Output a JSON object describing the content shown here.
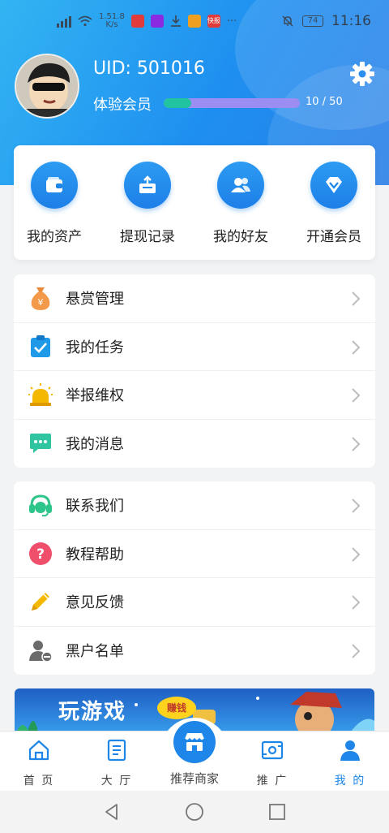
{
  "status_bar": {
    "speed": "1.51.8",
    "speed_unit": "K/s",
    "app_badge_text": "快报",
    "more": "···",
    "battery": "74",
    "time": "11:16"
  },
  "profile": {
    "uid": "UID: 501016",
    "member_level": "体验会员",
    "progress_text": "10 / 50",
    "progress_value": 10,
    "progress_max": 50
  },
  "quick_actions": [
    {
      "label": "我的资产",
      "icon": "wallet-icon"
    },
    {
      "label": "提现记录",
      "icon": "withdraw-icon"
    },
    {
      "label": "我的好友",
      "icon": "friends-icon"
    },
    {
      "label": "开通会员",
      "icon": "diamond-icon"
    }
  ],
  "menu_group1": [
    {
      "label": "悬赏管理",
      "icon": "money-bag-icon"
    },
    {
      "label": "我的任务",
      "icon": "task-check-icon"
    },
    {
      "label": "举报维权",
      "icon": "alarm-light-icon"
    },
    {
      "label": "我的消息",
      "icon": "message-icon"
    }
  ],
  "menu_group2": [
    {
      "label": "联系我们",
      "icon": "headset-icon"
    },
    {
      "label": "教程帮助",
      "icon": "help-icon"
    },
    {
      "label": "意见反馈",
      "icon": "pencil-icon"
    },
    {
      "label": "黑户名单",
      "icon": "blocked-user-icon"
    }
  ],
  "banner": {
    "title": "玩游戏",
    "tag": "赚钱"
  },
  "tabs": [
    {
      "label": "首 页",
      "icon": "home-icon",
      "active": false
    },
    {
      "label": "大 厅",
      "icon": "hall-icon",
      "active": false
    },
    {
      "label": "推荐商家",
      "icon": "store-icon",
      "active": false
    },
    {
      "label": "推 广",
      "icon": "promote-icon",
      "active": false
    },
    {
      "label": "我 的",
      "icon": "user-icon",
      "active": true
    }
  ],
  "colors": {
    "accent": "#1e86e8",
    "progress_fill": "#22c3a0",
    "progress_track": "#9b8df2"
  }
}
